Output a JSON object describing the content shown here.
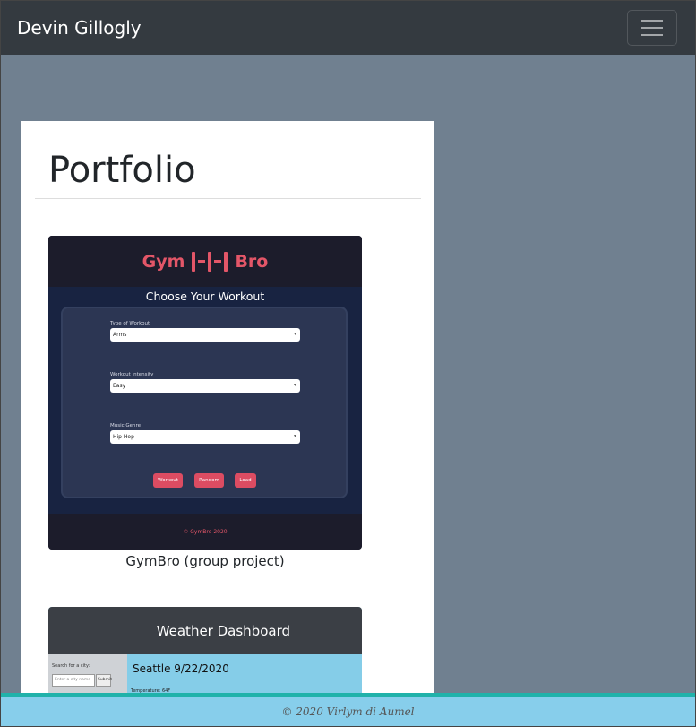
{
  "navbar": {
    "brand": "Devin Gillogly",
    "toggler_icon": "hamburger-menu-icon"
  },
  "main": {
    "title": "Portfolio",
    "projects": [
      {
        "caption": "GymBro (group project)",
        "thumb": {
          "logo_left": "Gym",
          "logo_right": "Bro",
          "subtitle": "Choose Your Workout",
          "fields": [
            {
              "label": "Type of Workout",
              "value": "Arms"
            },
            {
              "label": "Workout Intensity",
              "value": "Easy"
            },
            {
              "label": "Music Genre",
              "value": "Hip Hop"
            }
          ],
          "buttons": [
            "Workout",
            "Random",
            "Load"
          ],
          "footer": "© GymBro 2020"
        }
      },
      {
        "thumb": {
          "header": "Weather Dashboard",
          "search_label": "Search for a city:",
          "search_placeholder": "Enter a city name",
          "submit": "Submit",
          "city": "Seattle  9/22/2020",
          "temperature": "Temperature: 64F"
        }
      }
    ]
  },
  "footer": {
    "text": "© 2020 Virlym di Aumel"
  },
  "colors": {
    "navbar": "#343a40",
    "background": "#708090",
    "footer": "#87ceeb",
    "footer_border": "#20b2aa",
    "accent": "#e35668"
  }
}
